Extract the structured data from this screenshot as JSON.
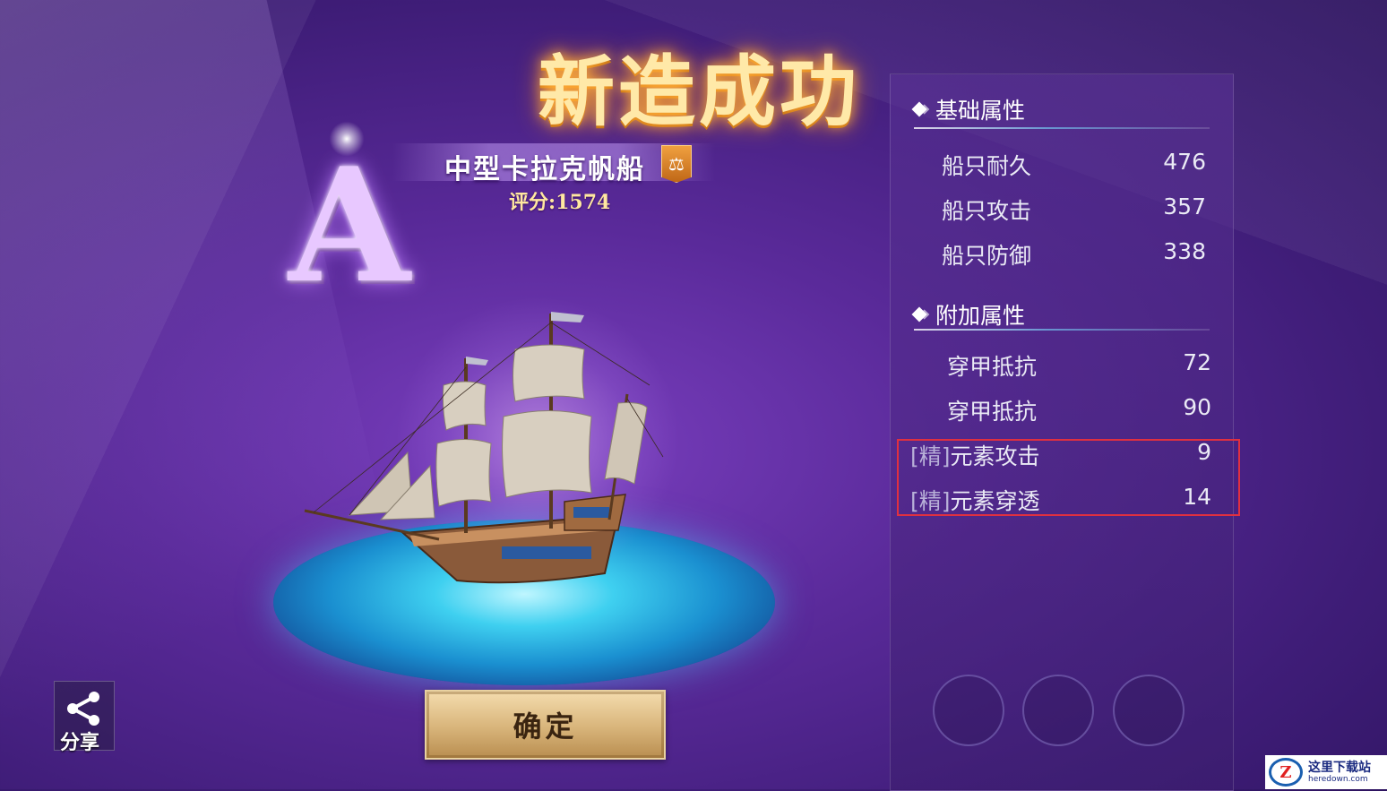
{
  "title": "新造成功",
  "grade": "A",
  "ship": {
    "name": "中型卡拉克帆船",
    "badge_icon": "scales-icon",
    "score_label": "评分:",
    "score_value": "1574"
  },
  "confirm_label": "确定",
  "share_label": "分享",
  "basic_section": {
    "title": "基础属性",
    "attrs": [
      {
        "label": "船只耐久",
        "value": "476"
      },
      {
        "label": "船只攻击",
        "value": "357"
      },
      {
        "label": "船只防御",
        "value": "338"
      }
    ]
  },
  "extra_section": {
    "title": "附加属性",
    "attrs": [
      {
        "tag": "",
        "label": "穿甲抵抗",
        "value": "72"
      },
      {
        "tag": "",
        "label": "穿甲抵抗",
        "value": "90"
      },
      {
        "tag": "[精]",
        "label": "元素攻击",
        "value": "9"
      },
      {
        "tag": "[精]",
        "label": "元素穿透",
        "value": "14"
      }
    ]
  },
  "watermark": {
    "logo": "Z",
    "cn": "这里下载站",
    "en": "heredown.com"
  },
  "colors": {
    "highlight": "#e03040",
    "title_glow": "#ffb340",
    "water": "#3fd0f0"
  }
}
